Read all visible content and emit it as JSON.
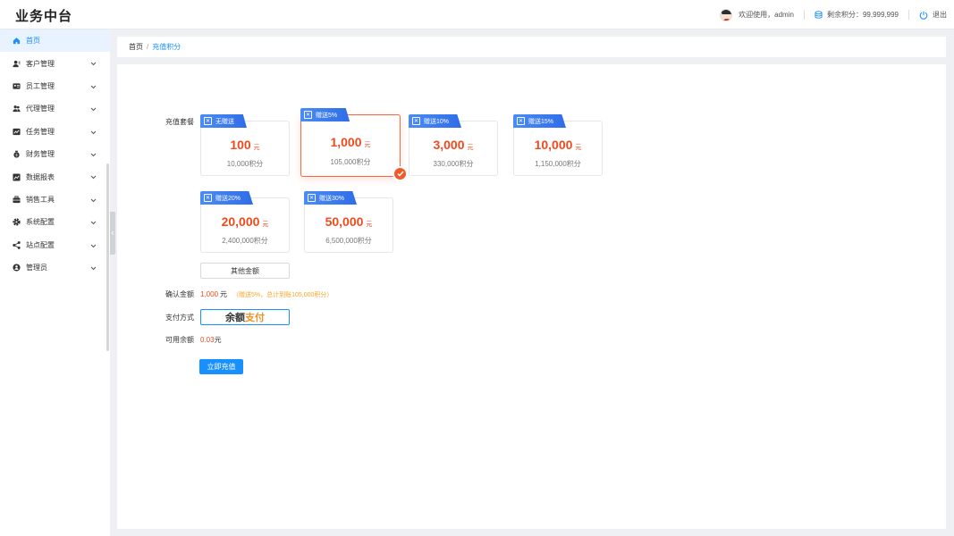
{
  "app": {
    "logo": "业务中台"
  },
  "header": {
    "welcome": "欢迎使用，admin",
    "points_label": "剩余积分：99,999,999",
    "logout": "退出"
  },
  "sidebar": {
    "items": [
      {
        "label": "首页",
        "icon": "home-icon",
        "active": true
      },
      {
        "label": "客户管理",
        "icon": "customer-icon"
      },
      {
        "label": "员工管理",
        "icon": "employee-icon"
      },
      {
        "label": "代理管理",
        "icon": "agent-icon"
      },
      {
        "label": "任务管理",
        "icon": "task-icon"
      },
      {
        "label": "财务管理",
        "icon": "finance-icon"
      },
      {
        "label": "数据报表",
        "icon": "report-icon"
      },
      {
        "label": "销售工具",
        "icon": "tools-icon"
      },
      {
        "label": "系统配置",
        "icon": "settings-icon"
      },
      {
        "label": "站点配置",
        "icon": "share-icon"
      },
      {
        "label": "管理员",
        "icon": "admin-icon"
      }
    ]
  },
  "breadcrumb": {
    "home": "首页",
    "separator": "/",
    "current": "充值积分"
  },
  "form": {
    "package_label": "充值套餐",
    "confirm_label": "确认金额",
    "payment_label": "支付方式",
    "balance_label": "可用余额",
    "yuan": "元",
    "packages": [
      {
        "tag": "无赠送",
        "amount": "100",
        "points": "10,000积分",
        "selected": false
      },
      {
        "tag": "赠送5%",
        "amount": "1,000",
        "points": "105,000积分",
        "selected": true
      },
      {
        "tag": "赠送10%",
        "amount": "3,000",
        "points": "330,000积分",
        "selected": false
      },
      {
        "tag": "赠送15%",
        "amount": "10,000",
        "points": "1,150,000积分",
        "selected": false
      },
      {
        "tag": "赠送20%",
        "amount": "20,000",
        "points": "2,400,000积分",
        "selected": false
      },
      {
        "tag": "赠送30%",
        "amount": "50,000",
        "points": "6,500,000积分",
        "selected": false
      }
    ],
    "other_amount": "其他金额",
    "confirm_amount": "1,000",
    "confirm_note": "（赠送5%，总计到账105,000积分）",
    "payment_text_1": "余额",
    "payment_text_2": "支付",
    "balance": "0.03",
    "submit": "立即充值"
  },
  "colors": {
    "accent": "#1890ff",
    "price": "#f04a1e",
    "selected_border": "#f06a44",
    "note": "#f5a623"
  }
}
